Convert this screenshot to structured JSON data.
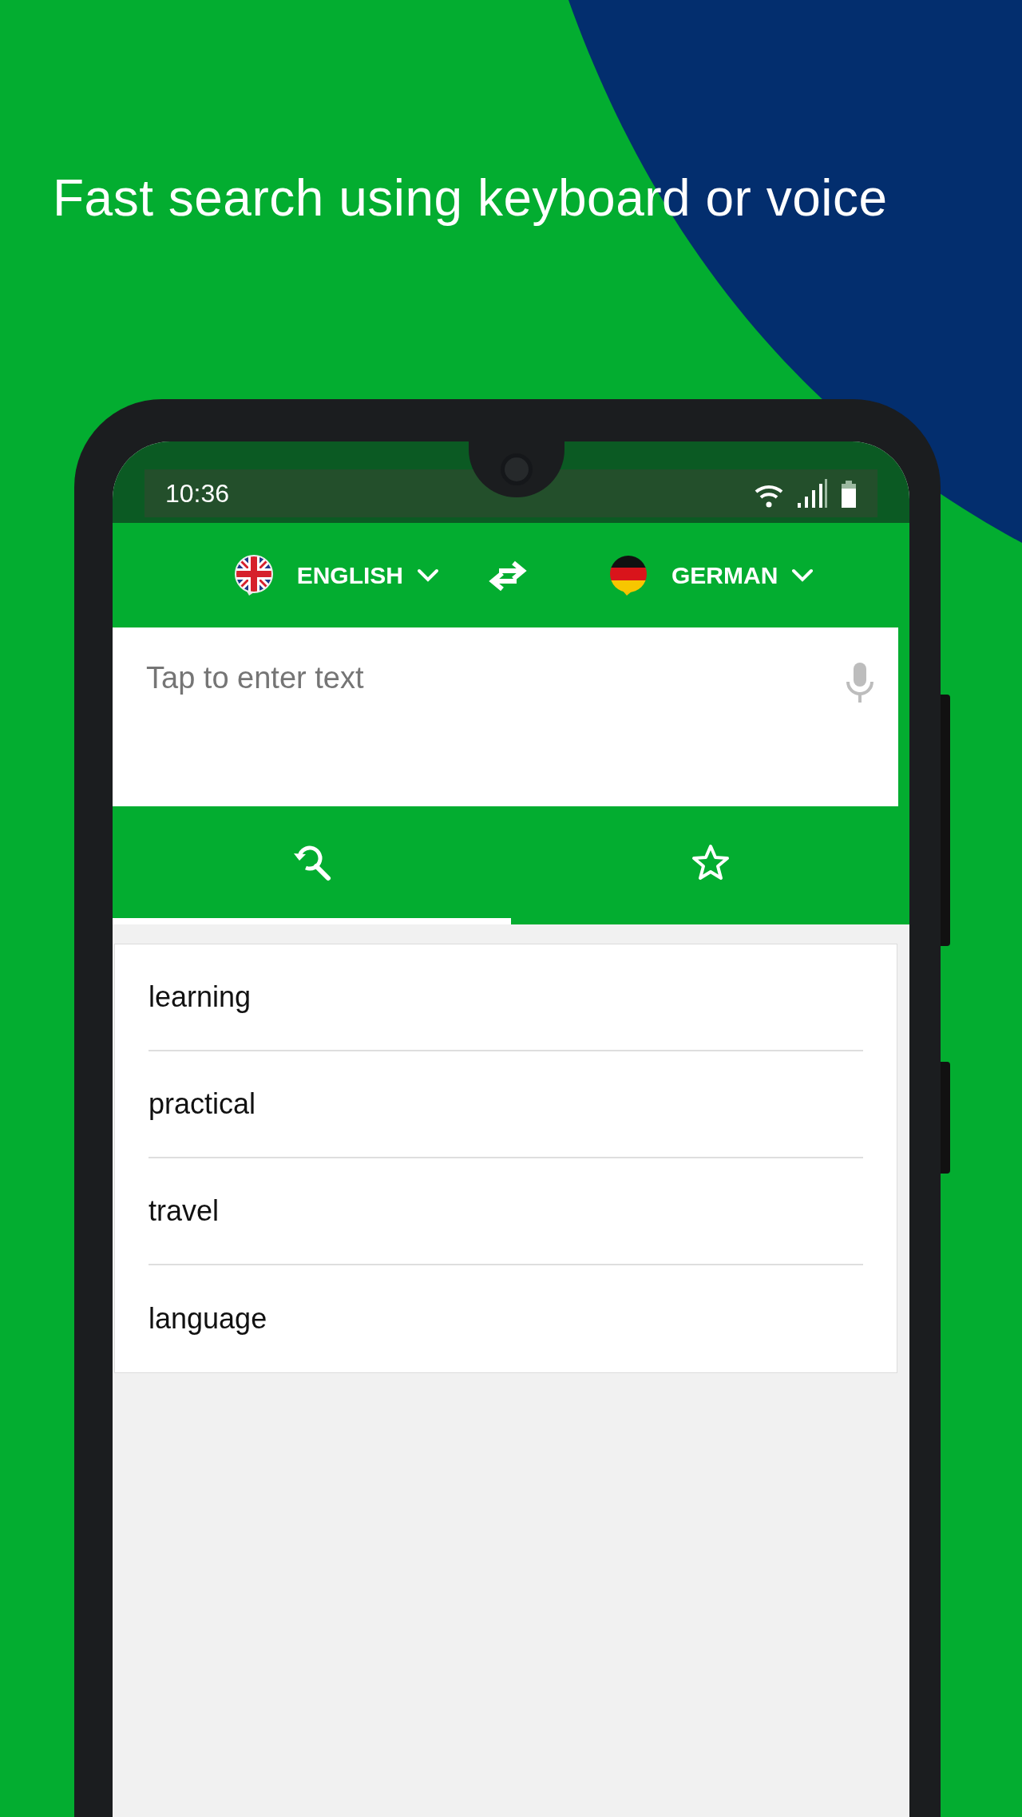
{
  "headline": "Fast search using keyboard or voice",
  "status_bar": {
    "time": "10:36"
  },
  "languages": [
    {
      "label": "ENGLISH"
    },
    {
      "label": "GERMAN"
    }
  ],
  "input": {
    "placeholder": "Tap to enter text"
  },
  "tabs": [
    {
      "kind": "history",
      "selected": true
    },
    {
      "kind": "favorites",
      "selected": false
    }
  ],
  "results": [
    "learning",
    "practical",
    "travel",
    "language"
  ]
}
